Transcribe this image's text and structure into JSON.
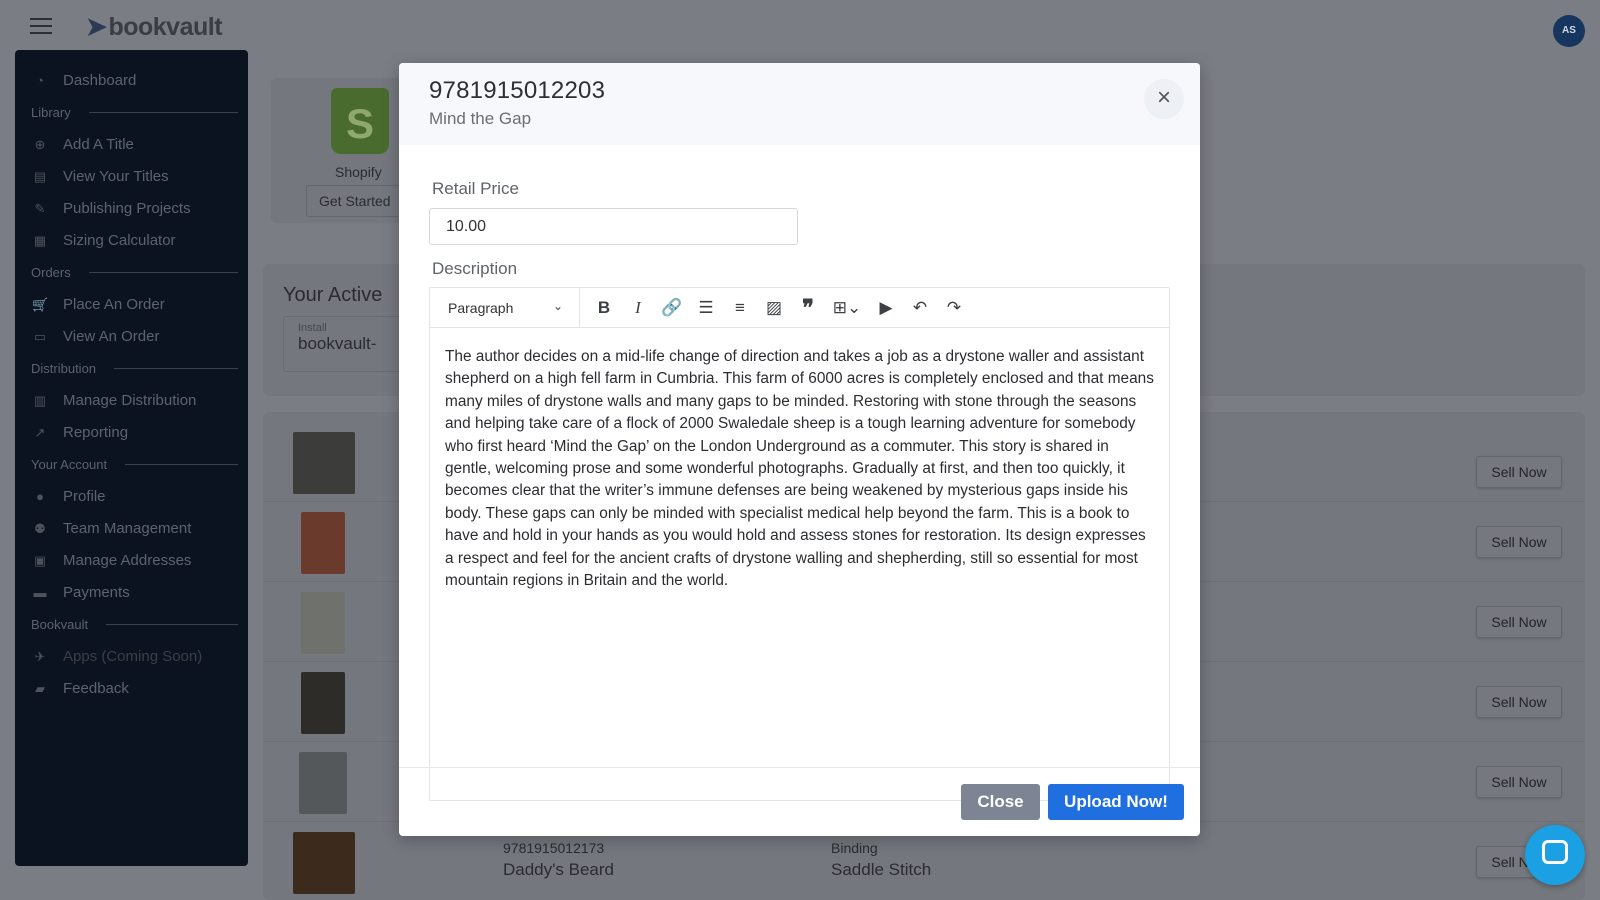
{
  "app": {
    "logo": "bookvault",
    "avatar_initials": "AS"
  },
  "sidebar": {
    "dashboard": "Dashboard",
    "sections": [
      {
        "heading": "Library",
        "items": [
          "Add A Title",
          "View Your Titles",
          "Publishing Projects",
          "Sizing Calculator"
        ]
      },
      {
        "heading": "Orders",
        "items": [
          "Place An Order",
          "View An Order"
        ]
      },
      {
        "heading": "Distribution",
        "items": [
          "Manage Distribution",
          "Reporting"
        ]
      },
      {
        "heading": "Your Account",
        "items": [
          "Profile",
          "Team Management",
          "Manage Addresses",
          "Payments"
        ]
      },
      {
        "heading": "Bookvault",
        "items": [
          "Apps (Coming Soon)",
          "Feedback"
        ]
      }
    ]
  },
  "background": {
    "shopify_label": "Shopify",
    "get_started": "Get Started",
    "active_title": "Your Active",
    "install_label": "Install",
    "install_value": "bookvault-",
    "sell_label": "Sell Now",
    "last_row": {
      "isbn": "9781915012173",
      "title": "Daddy's Beard",
      "binding_label": "Binding",
      "binding": "Saddle Stitch"
    }
  },
  "modal": {
    "isbn": "9781915012203",
    "title": "Mind the Gap",
    "retail_price_label": "Retail Price",
    "retail_price_value": "10.00",
    "description_label": "Description",
    "paragraph_select": "Paragraph",
    "description": "The author decides on a mid-life change of direction and takes a job as a drystone waller and assistant shepherd on a high fell farm in Cumbria. This farm of 6000 acres is completely enclosed and that means many miles of drystone walls and many gaps to be minded. Restoring with stone through the seasons and helping take care of a flock of 2000 Swaledale sheep is a tough learning adventure for somebody who first heard ‘Mind the Gap’ on the London Underground as a commuter. This story is shared in gentle, welcoming prose and some wonderful photographs. Gradually at first, and then too quickly, it becomes clear that the writer’s immune defenses are being weakened by mysterious gaps inside his body. These gaps can only be minded with specialist medical help beyond the farm. This is a book to have and hold in your hands as you would hold and assess stones for restoration. Its design expresses a respect and feel for the ancient crafts of drystone walling and shepherding, still so essential for most mountain regions in Britain and the world.",
    "close_button": "Close",
    "upload_button": "Upload Now!"
  },
  "colors": {
    "primary": "#1f6fe0",
    "secondary": "#7d8594",
    "overlay": "#7a7d84",
    "sidebar": "#0c1320"
  }
}
